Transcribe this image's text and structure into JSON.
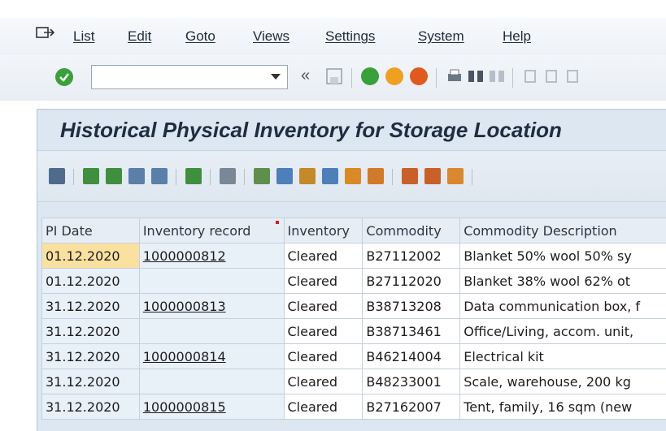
{
  "menu": {
    "items": [
      "List",
      "Edit",
      "Goto",
      "Views",
      "Settings",
      "System",
      "Help"
    ]
  },
  "toolbar": {
    "command_value": "",
    "back_glyph": "«"
  },
  "report": {
    "title": "Historical Physical Inventory for Storage Location"
  },
  "grid": {
    "columns": [
      "PI Date",
      "Inventory record",
      "Inventory",
      "Commodity",
      "Commodity Description"
    ],
    "rows": [
      {
        "pi_date": "01.12.2020",
        "record": "1000000812",
        "status": "Cleared",
        "commodity": "B27112002",
        "description": "Blanket 50% wool 50% sy"
      },
      {
        "pi_date": "01.12.2020",
        "record": "",
        "status": "Cleared",
        "commodity": "B27112020",
        "description": "Blanket 38% wool 62% ot"
      },
      {
        "pi_date": "31.12.2020",
        "record": "1000000813",
        "status": "Cleared",
        "commodity": "B38713208",
        "description": "Data communication box, f"
      },
      {
        "pi_date": "31.12.2020",
        "record": "",
        "status": "Cleared",
        "commodity": "B38713461",
        "description": "Office/Living, accom. unit,"
      },
      {
        "pi_date": "31.12.2020",
        "record": "1000000814",
        "status": "Cleared",
        "commodity": "B46214004",
        "description": "Electrical kit"
      },
      {
        "pi_date": "31.12.2020",
        "record": "",
        "status": "Cleared",
        "commodity": "B48233001",
        "description": "Scale, warehouse, 200 kg"
      },
      {
        "pi_date": "31.12.2020",
        "record": "1000000815",
        "status": "Cleared",
        "commodity": "B27162007",
        "description": "Tent, family, 16 sqm (new"
      }
    ]
  },
  "icons": {
    "menu": "menu-toggle-icon",
    "enter": "enter-check-icon",
    "colors": {
      "green": "#3aa03a",
      "orange": "#f0a020",
      "red": "#e05a1e",
      "selected_cell": "#fbe1a0"
    }
  }
}
